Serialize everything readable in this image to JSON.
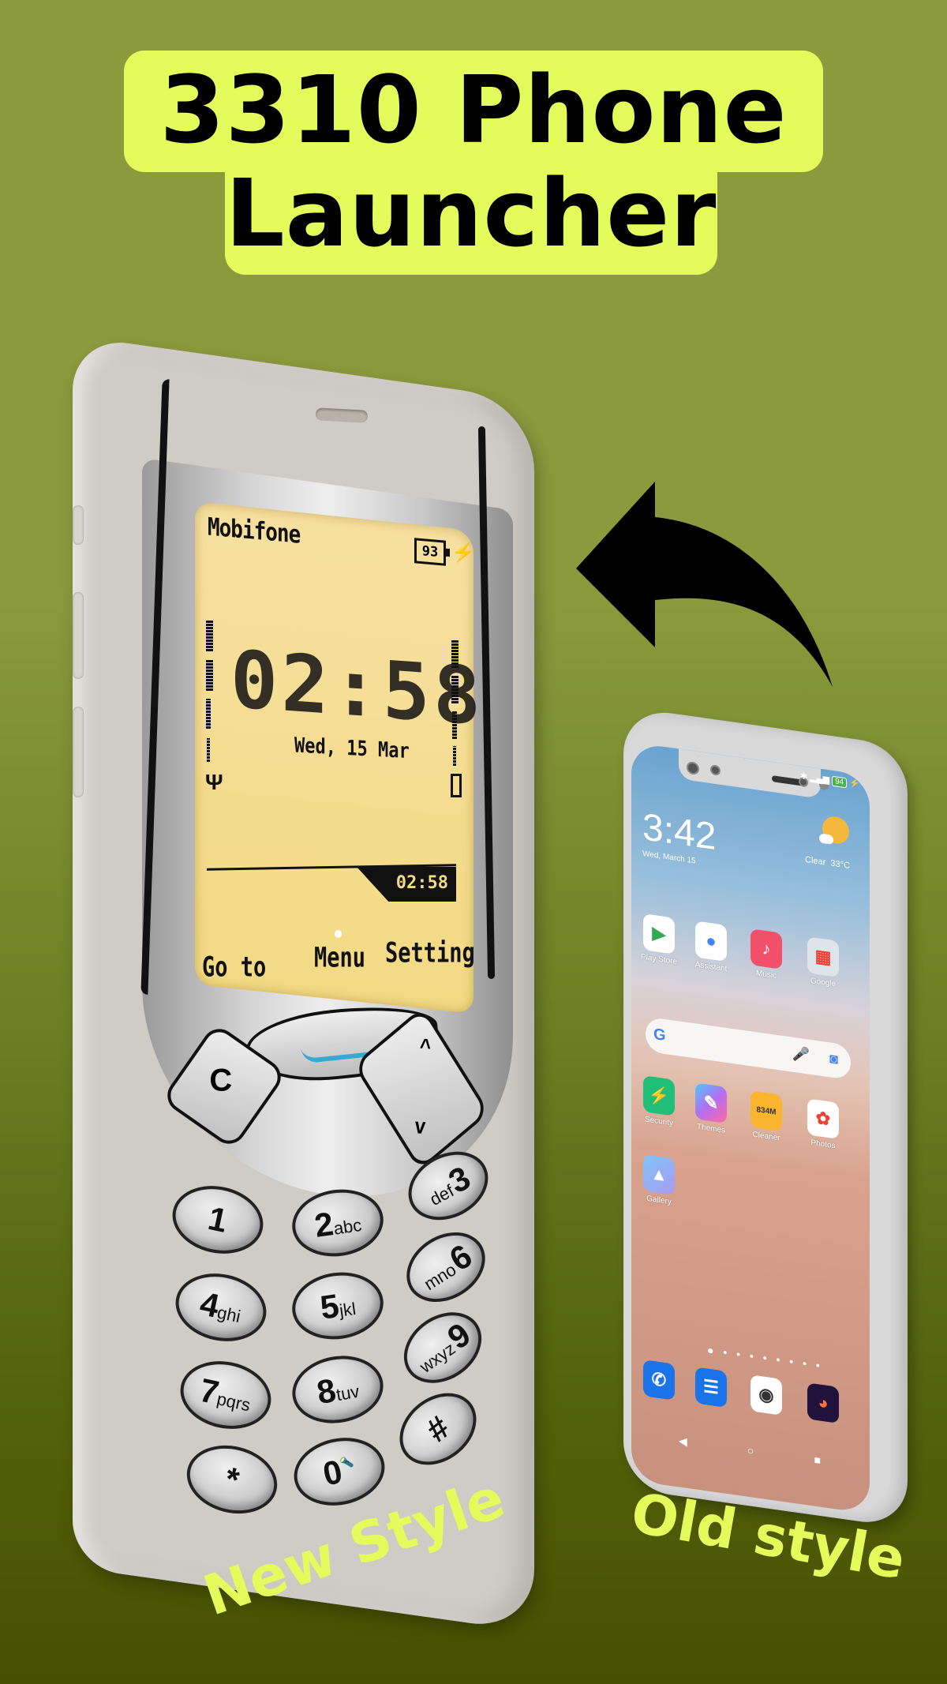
{
  "title": {
    "line1": "3310 Phone",
    "line2": "Launcher"
  },
  "colors": {
    "background_top": "#8b9a3d",
    "background_bottom": "#465100",
    "accent": "#e4fb5c",
    "lcd": "#f3da84",
    "nav_indicator": "#35a8d4"
  },
  "nokia": {
    "screen": {
      "carrier": "Mobifone",
      "battery_level": "93",
      "charging_icon": "lightning-bolt",
      "clock": "02:58",
      "date": "Wed, 15 Mar",
      "small_clock": "02:58",
      "signal_icon": "antenna",
      "battery_indicator_icon": "battery-bar",
      "softkeys": {
        "left": "Go to",
        "center": "Menu",
        "right": "Setting"
      }
    },
    "nav_keys": {
      "clear": "C",
      "up": "^",
      "down": "v"
    },
    "keypad": [
      {
        "num": "1",
        "letters": ""
      },
      {
        "num": "2",
        "letters": "abc"
      },
      {
        "num": "3",
        "letters": "def"
      },
      {
        "num": "4",
        "letters": "ghi"
      },
      {
        "num": "5",
        "letters": "jkl"
      },
      {
        "num": "6",
        "letters": "mno"
      },
      {
        "num": "7",
        "letters": "pqrs"
      },
      {
        "num": "8",
        "letters": "tuv"
      },
      {
        "num": "9",
        "letters": "wxyz"
      },
      {
        "num": "*",
        "letters": ""
      },
      {
        "num": "0",
        "letters": "🔦"
      },
      {
        "num": "#",
        "letters": ""
      }
    ]
  },
  "smartphone": {
    "status": {
      "bluetooth": "✱",
      "signal": "▂▄▆",
      "battery": "94",
      "charging": "⚡"
    },
    "time": "3:42",
    "date": "Wed, March 15",
    "weather": {
      "condition": "Clear",
      "temperature": "33°C"
    },
    "apps_row1": [
      {
        "label": "Play Store",
        "icon": "▶",
        "color": "#ffffff",
        "fg": "#34a853"
      },
      {
        "label": "Assistant",
        "icon": "●",
        "color": "#ffffff",
        "fg": "#4285f4"
      },
      {
        "label": "Music",
        "icon": "♪",
        "color": "#f2506a",
        "fg": "#ffffff"
      },
      {
        "label": "Google",
        "icon": "▦",
        "color": "#dfe3ea",
        "fg": "#ea4335"
      }
    ],
    "apps_row2": [
      {
        "label": "Security",
        "icon": "⚡",
        "color": "#1fbf7a",
        "fg": "#ffffff"
      },
      {
        "label": "Themes",
        "icon": "✎",
        "color": "#b46ef0",
        "fg": "#ffffff"
      },
      {
        "label": "Cleaner",
        "icon": "834M",
        "color": "#f9b52d",
        "fg": "#333333"
      },
      {
        "label": "Photos",
        "icon": "✿",
        "color": "#ffffff",
        "fg": "#ea4335"
      }
    ],
    "apps_row3": [
      {
        "label": "Gallery",
        "icon": "▲",
        "color": "#8fa6f2",
        "fg": "#ffffff"
      }
    ],
    "dock": [
      {
        "label": "Phone",
        "icon": "✆",
        "color": "#1a73e8",
        "fg": "#ffffff"
      },
      {
        "label": "Messages",
        "icon": "☰",
        "color": "#1a73e8",
        "fg": "#ffffff"
      },
      {
        "label": "Camera",
        "icon": "◉",
        "color": "#ffffff",
        "fg": "#333333"
      },
      {
        "label": "Firefox",
        "icon": "◕",
        "color": "#20123a",
        "fg": "#ff7139"
      }
    ],
    "page_dots": "● • • • • • • • •",
    "navbar": {
      "back": "◀",
      "home": "○",
      "recents": "■"
    }
  },
  "labels": {
    "new_style": "New Style",
    "old_style": "Old style"
  }
}
